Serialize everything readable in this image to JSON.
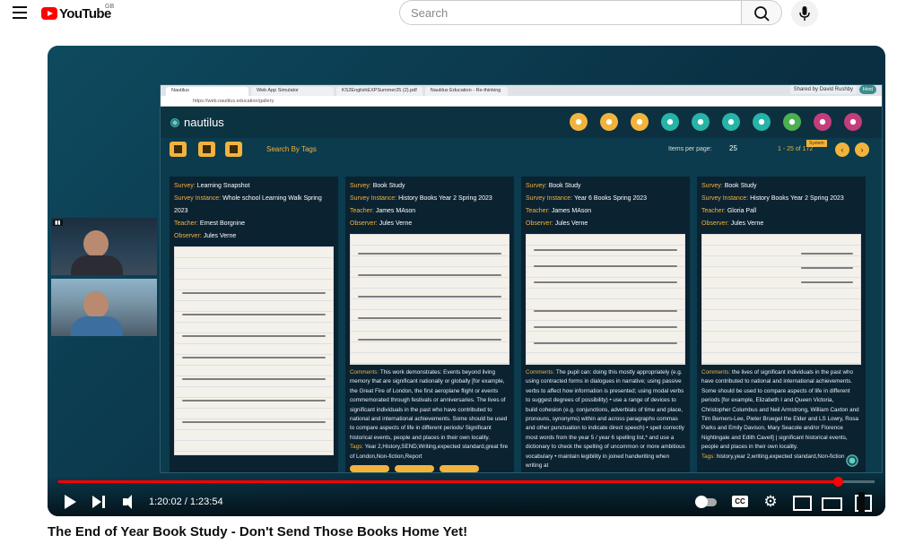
{
  "youtube": {
    "logo_text": "YouTube",
    "region": "GB",
    "search": {
      "placeholder": "Search"
    }
  },
  "video": {
    "title": "The End of Year Book Study - Don't Send Those Books Home Yet!",
    "time_current": "1:20:02",
    "time_separator": " / ",
    "time_total": "1:23:54",
    "progress": 0.9545
  },
  "browser": {
    "tabs": [
      "Nautilus",
      "Web App Simulator",
      "KS2EnglishEXPSummer25 (2).pdf",
      "Nautilus Education - Re-thinking"
    ],
    "url": "https://web.nautilus.education/gallery",
    "shared_by": "Shared by David Rushby",
    "host_badge": "Host"
  },
  "app": {
    "brand": "nautilus",
    "nav_icon_colors": [
      "#f2b33d",
      "#f2b33d",
      "#f2b33d",
      "#26b3a8",
      "#26b3a8",
      "#26b3a8",
      "#26b3a8",
      "#4caf50",
      "#c43d7b",
      "#c43d7b"
    ],
    "tooltip": "System",
    "search_tags": "Search By Tags",
    "items_per_page_label": "Items per page:",
    "items_per_page_value": "25",
    "range": "1 - 25 of 172"
  },
  "cards": [
    {
      "survey_label": "Survey:",
      "survey": "Learning Snapshot",
      "instance_label": "Survey Instance:",
      "instance": "Whole school Learning Walk Spring 2023",
      "teacher_label": "Teacher:",
      "teacher": "Ernest Borgnine",
      "observer_label": "Observer:",
      "observer": "Jules Verne"
    },
    {
      "survey_label": "Survey:",
      "survey": "Book Study",
      "instance_label": "Survey Instance:",
      "instance": "History Books Year 2 Spring 2023",
      "teacher_label": "Teacher:",
      "teacher": "James MAson",
      "observer_label": "Observer:",
      "observer": "Jules Verne",
      "comments_label": "Comments:",
      "comments": "This work demonstrates: Events beyond living memory that are significant nationally or globally [for example, the Great Fire of London, the first aeroplane flight or events commemorated through festivals or anniversaries. The lives of significant individuals in the past who have contributed to national and international achievements. Some should be used to compare aspects of life in different periods/ Significant historical events, people and places in their own locality.",
      "tags_label": "Tags:",
      "tags": "Year 2,History,SEND,Writing,expected standard,great fire of London,Non-fiction,Report"
    },
    {
      "survey_label": "Survey:",
      "survey": "Book Study",
      "instance_label": "Survey Instance:",
      "instance": "Year 6 Books Spring 2023",
      "teacher_label": "Teacher:",
      "teacher": "James MAson",
      "observer_label": "Observer:",
      "observer": "Jules Verne",
      "comments_label": "Comments:",
      "comments": "The pupil can: doing this mostly appropriately (e.g. using contracted forms in dialogues in narrative; using passive verbs to affect how information is presented; using modal verbs to suggest degrees of possibility) • use a range of devices to build cohesion (e.g. conjunctions, adverbials of time and place, pronouns, synonyms) within and across paragraphs commas and other punctuation to indicate direct speech) • spell correctly most words from the year 5 / year 6 spelling list,* and use a dictionary to check the spelling of uncommon or more ambitious vocabulary • maintain legibility in joined handwriting when writing at"
    },
    {
      "survey_label": "Survey:",
      "survey": "Book Study",
      "instance_label": "Survey Instance:",
      "instance": "History Books Year 2 Spring 2023",
      "teacher_label": "Teacher:",
      "teacher": "Gloria Pall",
      "observer_label": "Observer:",
      "observer": "Jules Verne",
      "comments_label": "Comments:",
      "comments": "the lives of significant individuals in the past who have contributed to national and international achievements. Some should be used to compare aspects of life in different periods [for example, Elizabeth I and Queen Victoria, Christopher Columbus and Neil Armstrong, William Caxton and Tim Berners-Lee, Pieter Bruegel the Elder and LS Lowry, Rosa Parks and Emily Davison, Mary Seacole and/or Florence Nightingale and Edith Cavell] | significant historical events, people and places in their own locality.",
      "tags_label": "Tags:",
      "tags": "history,year 2,writing,expected standard,Non-fiction"
    }
  ]
}
